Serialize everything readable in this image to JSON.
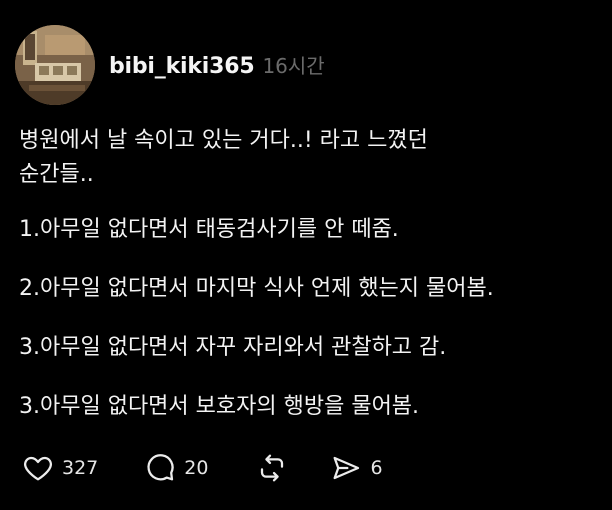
{
  "post": {
    "username": "bibi_kiki365",
    "timestamp": "16시간",
    "lines": [
      "병원에서 날 속이고 있는 거다..! 라고 느꼈던",
      "순간들..",
      "1.아무일 없다면서 태동검사기를 안 떼줌.",
      "2.아무일 없다면서 마지막 식사 언제 했는지 물어봄.",
      "3.아무일 없다면서 자꾸 자리와서 관찰하고 감.",
      "3.아무일 없다면서 보호자의 행방을 물어봄."
    ]
  },
  "actions": {
    "like_icon": "heart-icon",
    "like_count": "327",
    "comment_icon": "speech-bubble-icon",
    "comment_count": "20",
    "repost_icon": "repost-arrows-icon",
    "share_icon": "send-icon",
    "share_count": "6"
  }
}
